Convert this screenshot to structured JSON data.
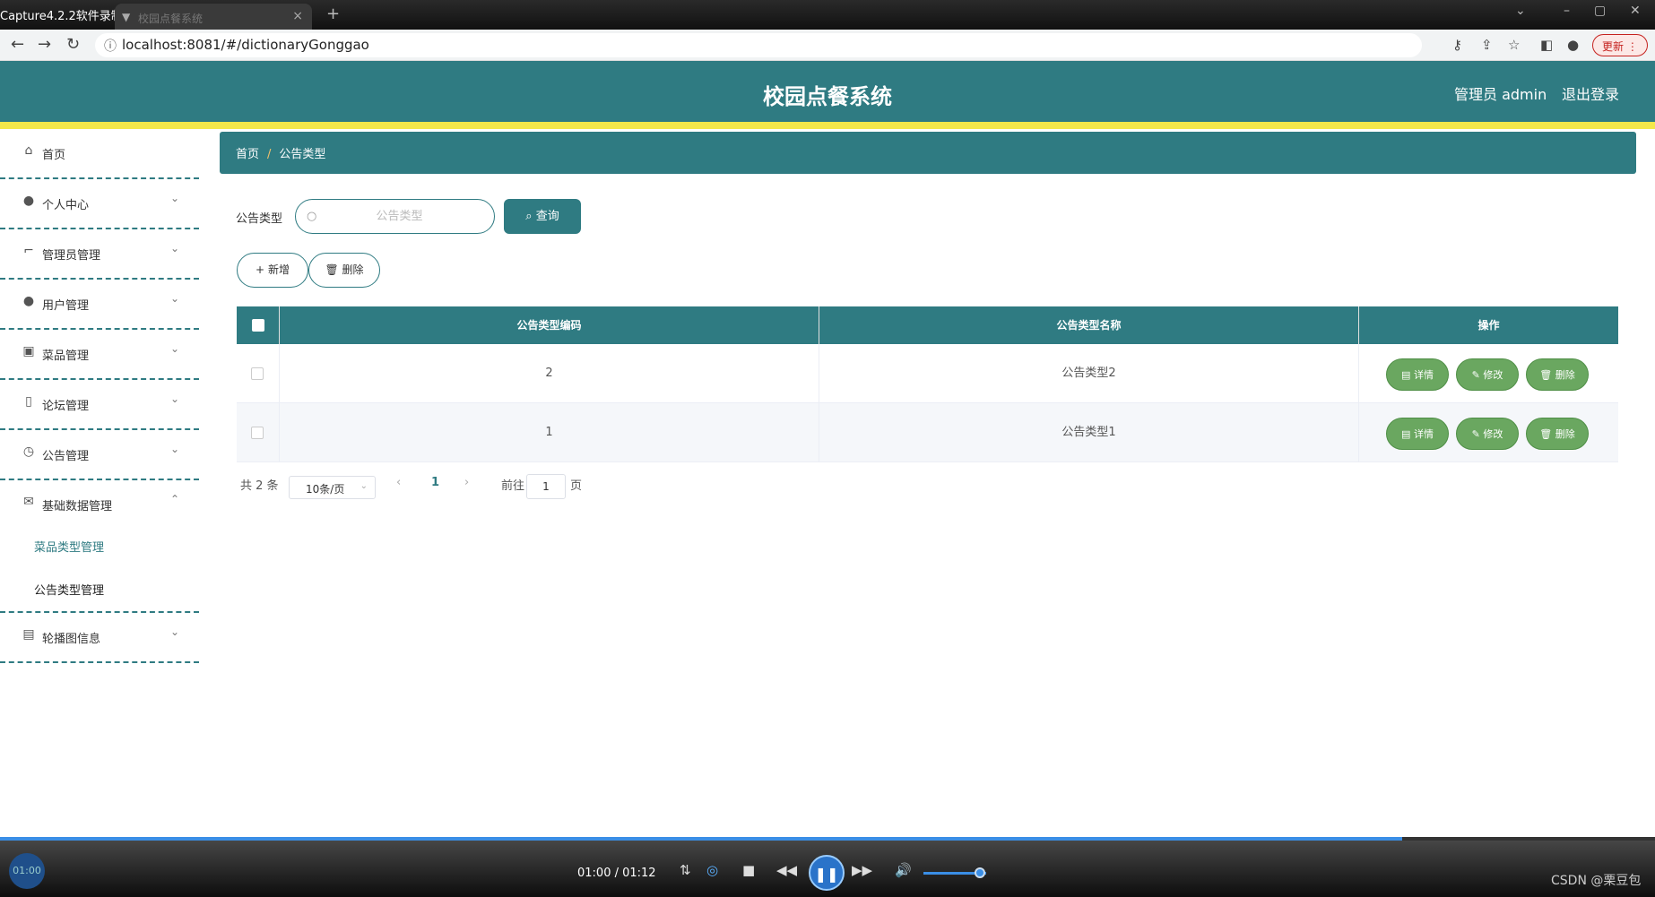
{
  "browser": {
    "recorder_label": "Capture4.2.2软件录制",
    "tab_title": "校园点餐系统",
    "url": "localhost:8081/#/dictionaryGonggao",
    "update_label": "更新"
  },
  "header": {
    "title": "校园点餐系统",
    "user": "管理员 admin",
    "logout": "退出登录"
  },
  "sidebar": {
    "items": [
      {
        "label": "首页",
        "icon": "home-icon"
      },
      {
        "label": "个人中心",
        "icon": "user-icon"
      },
      {
        "label": "管理员管理",
        "icon": "crop-icon"
      },
      {
        "label": "用户管理",
        "icon": "user-icon"
      },
      {
        "label": "菜品管理",
        "icon": "clipboard-icon"
      },
      {
        "label": "论坛管理",
        "icon": "mic-icon"
      },
      {
        "label": "公告管理",
        "icon": "clock-icon"
      },
      {
        "label": "基础数据管理",
        "icon": "mail-icon"
      },
      {
        "label": "轮播图信息",
        "icon": "image-icon"
      }
    ],
    "submenu": [
      "菜品类型管理",
      "公告类型管理"
    ]
  },
  "breadcrumb": {
    "home": "首页",
    "sep": "/",
    "current": "公告类型"
  },
  "search": {
    "label": "公告类型",
    "placeholder": "公告类型",
    "query_button": "查询"
  },
  "toolbar": {
    "add": "新增",
    "delete": "删除"
  },
  "table": {
    "headers": [
      "公告类型编码",
      "公告类型名称",
      "操作"
    ],
    "rows": [
      {
        "code": "2",
        "name": "公告类型2"
      },
      {
        "code": "1",
        "name": "公告类型1"
      }
    ],
    "actions": {
      "detail": "详情",
      "edit": "修改",
      "delete": "删除"
    }
  },
  "pagination": {
    "total": "共 2 条",
    "page_size": "10条/页",
    "current_page": "1",
    "goto_prefix": "前往",
    "goto_value": "1",
    "goto_suffix": "页"
  },
  "player": {
    "bubble_time": "01:00",
    "time": "01:00 / 01:12",
    "progress_fraction": 0.847,
    "watermark": "CSDN @栗豆包"
  },
  "colors": {
    "primary": "#2f7b82",
    "accent_yellow": "#f4e84a",
    "action_green": "#6aa760"
  }
}
